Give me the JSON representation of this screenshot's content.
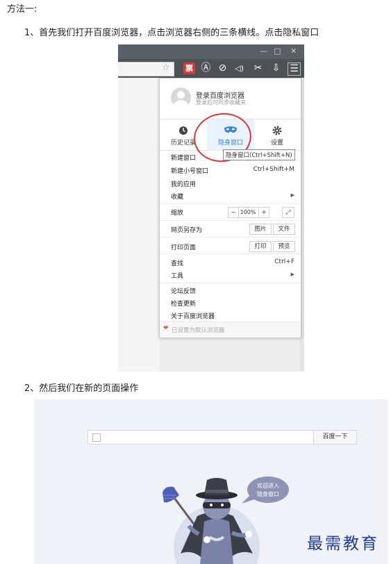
{
  "heading": "方法一:",
  "step1": "1、首先我们打开百度浏览器，点击浏览器右侧的三条横线。点击隐私窗口",
  "step2": "2、然后我们在新的页面操作",
  "browser": {
    "window_controls": [
      "—",
      "□",
      "✕"
    ],
    "toolbar_icons": {
      "ticket": "票",
      "a": "Ⓐ",
      "compass": "⊘",
      "speaker": "◁)",
      "scissors": "✂",
      "download": "⇩",
      "menu": "☰"
    },
    "star": "☆"
  },
  "menu": {
    "login_title": "登录百度浏览器",
    "login_subtitle": "登录后可同步收藏夹",
    "tabs": [
      {
        "label": "历史记录",
        "icon": "clock-icon"
      },
      {
        "label": "隐身窗口",
        "icon": "mask-icon"
      },
      {
        "label": "设置",
        "icon": "gear-icon"
      }
    ],
    "tooltip": "隐身窗口(Ctrl+Shift+N)",
    "items": {
      "new_window": "新建窗口",
      "new_small_window": "新建小号窗口",
      "new_small_window_shortcut": "Ctrl+Shift+M",
      "my_apps": "我的应用",
      "favorites": "收藏",
      "zoom": "缩放",
      "zoom_minus": "−",
      "zoom_value": "100%",
      "zoom_plus": "+",
      "save_as": "网页另存为",
      "save_image": "图片",
      "save_file": "文件",
      "print_page": "打印页面",
      "print": "打印",
      "preview": "预览",
      "find": "查找",
      "find_shortcut": "Ctrl+F",
      "tools": "工具",
      "forum_feedback": "论坛反馈",
      "check_update": "检查更新",
      "about": "关于百度浏览器",
      "default_browser": "已设置为默认浏览器"
    }
  },
  "incognito_page": {
    "search_button": "百度一下",
    "bubble_line1": "欢迎进入",
    "bubble_line2": "隐身窗口"
  },
  "watermark": "最需教育"
}
